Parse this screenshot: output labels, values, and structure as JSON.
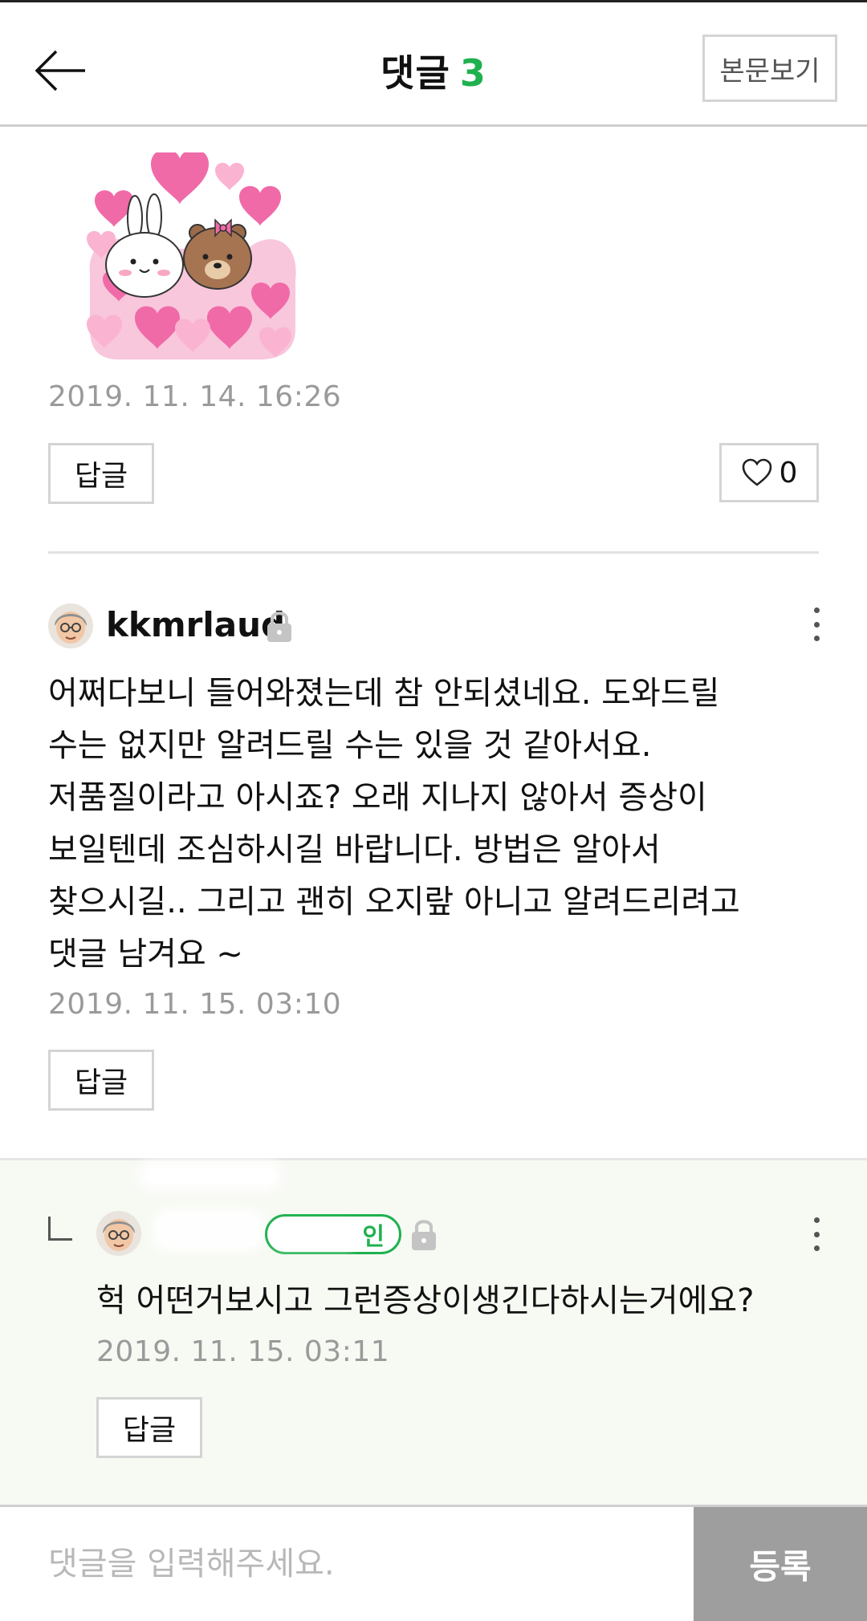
{
  "header": {
    "title": "댓글",
    "comment_count": "3",
    "view_article_label": "본문보기"
  },
  "first_comment": {
    "sticker": "brown-and-cony-hearts-sticker",
    "timestamp": "2019. 11. 14. 16:26",
    "reply_label": "답글",
    "like_count": "0"
  },
  "second_comment": {
    "username": "kkmrlaud",
    "body": "어쩌다보니 들어와졌는데 참 안되셨네요. 도와드릴\n수는 없지만 알려드릴 수는 있을 것 같아서요.\n저품질이라고 아시죠? 오래 지나지 않아서 증상이\n보일텐데 조심하시길 바랍니다. 방법은 알아서\n찾으시길.. 그리고 괜히 오지랖 아니고 알려드리려고\n댓글 남겨요 ~",
    "timestamp": "2019. 11. 15. 03:10",
    "reply_label": "답글"
  },
  "reply_comment": {
    "badge_label": "인",
    "body": "헉 어떤거보시고 그런증상이생긴다하시는거에요?",
    "timestamp": "2019. 11. 15. 03:11",
    "reply_label": "답글"
  },
  "composer": {
    "placeholder": "댓글을 입력해주세요.",
    "submit_label": "등록"
  },
  "colors": {
    "accent_green": "#1fb14e",
    "submit_bg": "#9e9e9e",
    "reply_bg": "#f7f9f3"
  }
}
